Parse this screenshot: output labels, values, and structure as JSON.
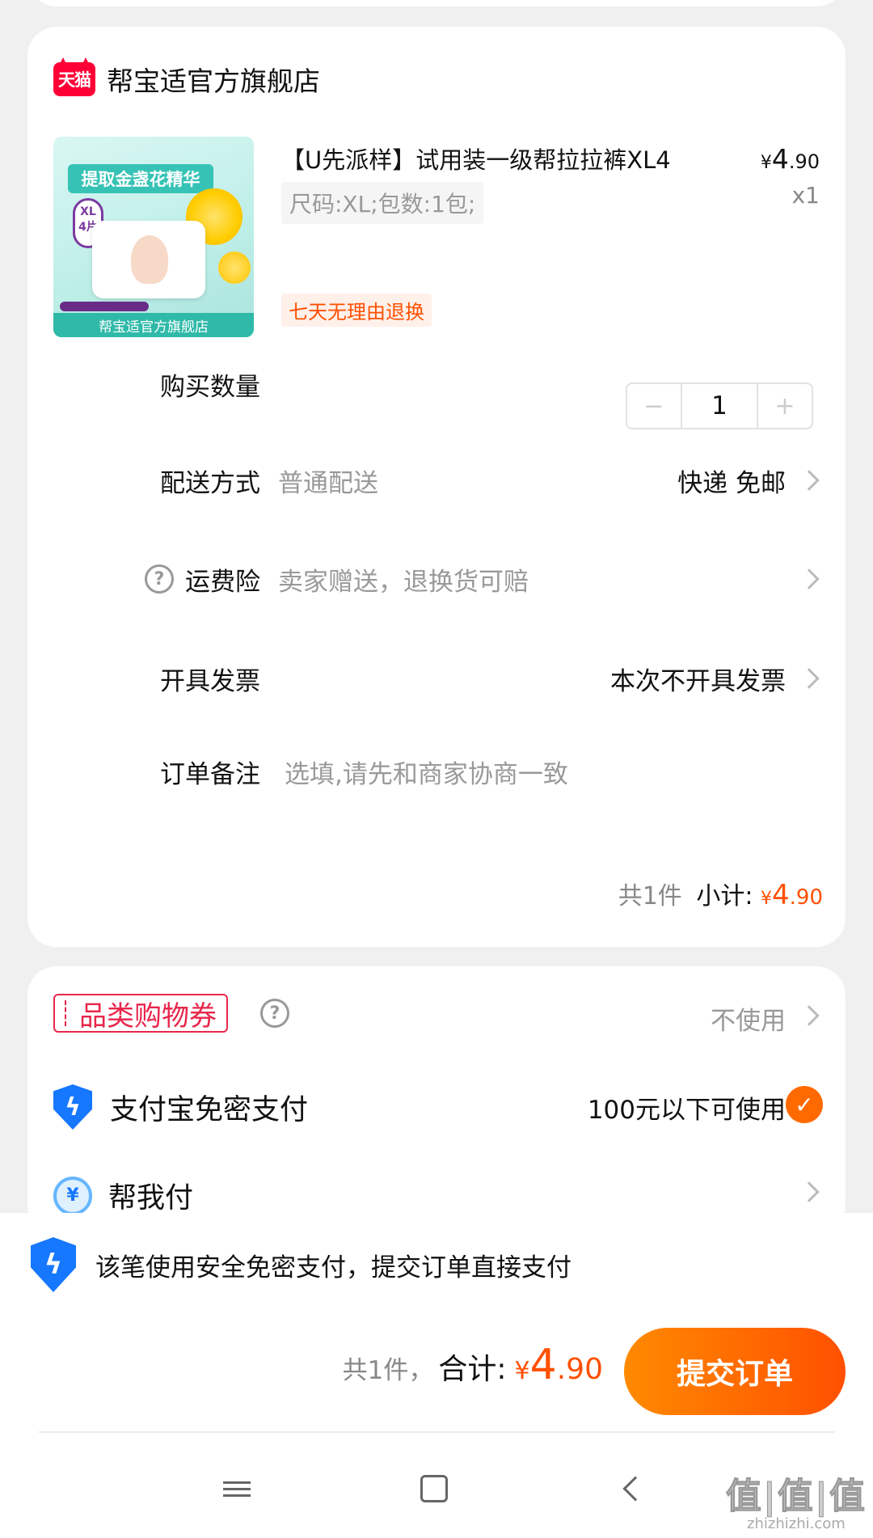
{
  "store": {
    "logo_text": "天猫",
    "name": "帮宝适官方旗舰店"
  },
  "product": {
    "image_banner": "提取金盏花精华",
    "image_size": "XL",
    "image_count": "4片",
    "image_footer": "帮宝适官方旗舰店",
    "title": "【U先派样】试用装一级帮拉拉裤XL4",
    "price_currency": "¥",
    "price_int": "4",
    "price_dec": ".90",
    "quantity_label": "x1",
    "spec": "尺码:XL;包数:1包;",
    "return_tag": "七天无理由退换"
  },
  "rows": {
    "quantity": {
      "label": "购买数量",
      "minus": "−",
      "value": "1",
      "plus": "+"
    },
    "delivery": {
      "label": "配送方式",
      "value": "普通配送",
      "right": "快递 免邮"
    },
    "insurance": {
      "label": "运费险",
      "value": "卖家赠送，退换货可赔",
      "help": "?"
    },
    "invoice": {
      "label": "开具发票",
      "right": "本次不开具发票"
    },
    "note": {
      "label": "订单备注",
      "placeholder": "选填,请先和商家协商一致"
    }
  },
  "subtotal": {
    "count": "共1件",
    "label": "小计:",
    "currency": "¥",
    "int": "4",
    "dec": ".90"
  },
  "payment": {
    "coupon_label": "品类购物券",
    "coupon_help": "?",
    "coupon_value": "不使用",
    "alipay_label": "支付宝免密支付",
    "alipay_right": "100元以下可使用",
    "check_mark": "✓",
    "help_pay_label": "帮我付",
    "help_pay_icon": "¥"
  },
  "bottom": {
    "secure_text": "该笔使用安全免密支付，提交订单直接支付",
    "total_count": "共1件，",
    "total_label": "合计:",
    "total_currency": "¥",
    "total_int": "4",
    "total_dec": ".90",
    "submit_label": "提交订单"
  },
  "watermark": {
    "big": "值|值|值",
    "small": "zhizhizhi.com"
  },
  "colors": {
    "accent": "#ff5000",
    "tmall_red": "#ff0036",
    "alipay_blue": "#1677ff",
    "coupon_red": "#e8264b"
  }
}
